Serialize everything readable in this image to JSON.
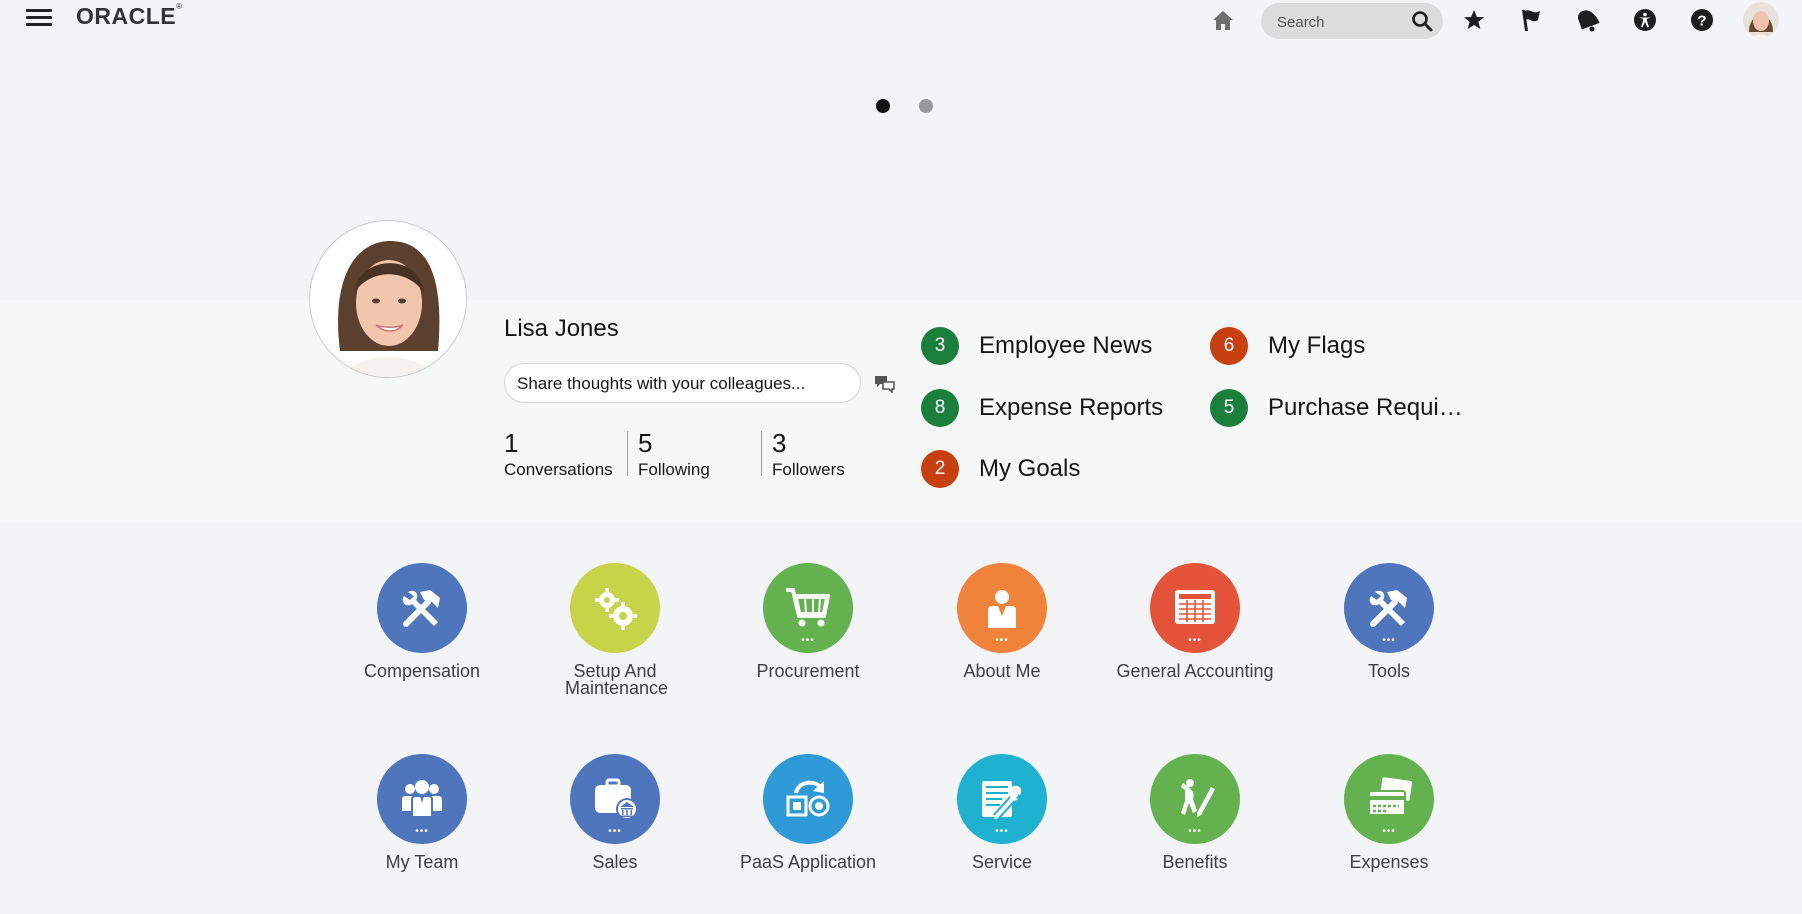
{
  "header": {
    "logo_text": "ORACLE",
    "logo_mark": "®",
    "search_placeholder": "Search",
    "icons": [
      "menu-icon",
      "home-icon",
      "search-icon",
      "favorites-star-icon",
      "flag-icon",
      "notifications-bell-icon",
      "accessibility-icon",
      "help-icon",
      "user-avatar"
    ]
  },
  "carousel": {
    "pages": 2,
    "active": 1
  },
  "profile": {
    "name": "Lisa Jones",
    "share_placeholder": "Share thoughts with your colleagues...",
    "stats": [
      {
        "value": "1",
        "label": "Conversations"
      },
      {
        "value": "5",
        "label": "Following"
      },
      {
        "value": "3",
        "label": "Followers"
      }
    ]
  },
  "notifications": [
    {
      "count": "3",
      "label": "Employee News",
      "color": "#1a7f3c"
    },
    {
      "count": "8",
      "label": "Expense Reports",
      "color": "#1a7f3c"
    },
    {
      "count": "2",
      "label": "My Goals",
      "color": "#c8400f"
    },
    {
      "count": "6",
      "label": "My Flags",
      "color": "#c8400f"
    },
    {
      "count": "5",
      "label": "Purchase Requi…",
      "color": "#1a7f3c"
    }
  ],
  "apps": [
    {
      "label": "Compensation",
      "color": "#4f76bd",
      "icon": "tools-icon",
      "more": false
    },
    {
      "label": "Setup And Maintenance",
      "color": "#c6d448",
      "icon": "gears-icon",
      "more": false
    },
    {
      "label": "Procurement",
      "color": "#63b24f",
      "icon": "cart-icon",
      "more": true
    },
    {
      "label": "About Me",
      "color": "#f0833a",
      "icon": "person-icon",
      "more": true
    },
    {
      "label": "General Accounting",
      "color": "#e5533a",
      "icon": "ledger-icon",
      "more": true
    },
    {
      "label": "Tools",
      "color": "#4f76bd",
      "icon": "tools-icon",
      "more": true
    },
    {
      "label": "My Team",
      "color": "#4f76bd",
      "icon": "team-icon",
      "more": true
    },
    {
      "label": "Sales",
      "color": "#4f76bd",
      "icon": "sales-icon",
      "more": true
    },
    {
      "label": "PaaS Application",
      "color": "#2e9ad8",
      "icon": "paas-icon",
      "more": false
    },
    {
      "label": "Service",
      "color": "#1fb1d0",
      "icon": "service-icon",
      "more": true
    },
    {
      "label": "Benefits",
      "color": "#63b24f",
      "icon": "benefits-icon",
      "more": true
    },
    {
      "label": "Expenses",
      "color": "#63b24f",
      "icon": "expenses-icon",
      "more": true
    }
  ]
}
